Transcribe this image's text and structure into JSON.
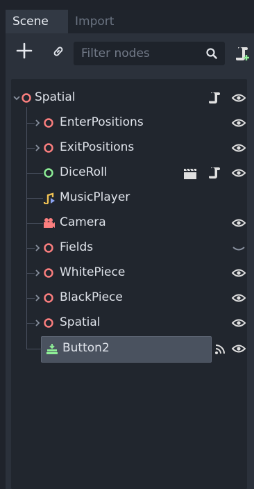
{
  "tabs": {
    "scene": "Scene",
    "import": "Import"
  },
  "toolbar": {
    "filter_placeholder": "Filter nodes"
  },
  "colors": {
    "node_red": "#fc7f7f",
    "node_green": "#8eef97",
    "text": "#dfe3ea",
    "eye": "#e0e0e0",
    "music": "#f0c254",
    "camera": "#fc7f7f"
  },
  "tree": {
    "root": {
      "label": "Spatial"
    },
    "children": [
      {
        "label": "EnterPositions",
        "icon": "spatial-node-icon",
        "expandable": true,
        "visible": true
      },
      {
        "label": "ExitPositions",
        "icon": "spatial-node-icon",
        "expandable": true,
        "visible": true
      },
      {
        "label": "DiceRoll",
        "icon": "control-node-icon",
        "expandable": false,
        "visible": true,
        "extra": [
          "clapperboard-icon",
          "script-icon"
        ]
      },
      {
        "label": "MusicPlayer",
        "icon": "audio-stream-player-icon",
        "expandable": false,
        "visible": null
      },
      {
        "label": "Camera",
        "icon": "camera-icon",
        "expandable": false,
        "visible": true
      },
      {
        "label": "Fields",
        "icon": "spatial-node-icon",
        "expandable": true,
        "visible": false
      },
      {
        "label": "WhitePiece",
        "icon": "spatial-node-icon",
        "expandable": true,
        "visible": true
      },
      {
        "label": "BlackPiece",
        "icon": "spatial-node-icon",
        "expandable": true,
        "visible": true
      },
      {
        "label": "Spatial",
        "icon": "spatial-node-icon",
        "expandable": true,
        "visible": true
      },
      {
        "label": "Button2",
        "icon": "button-node-icon",
        "expandable": false,
        "visible": true,
        "extra": [
          "signal-icon"
        ],
        "selected": true
      }
    ]
  }
}
